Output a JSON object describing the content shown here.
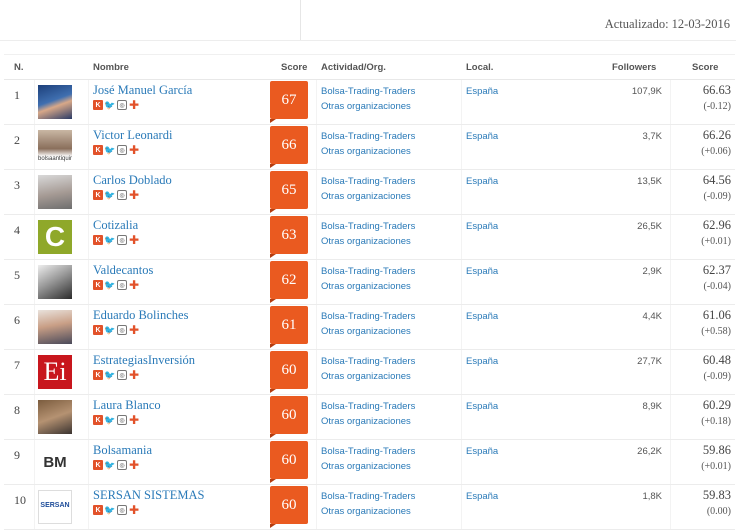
{
  "updated_label": "Actualizado: 12-03-2016",
  "columns": {
    "rank": "N.",
    "name": "Nombre",
    "score": "Score",
    "activity": "Actividad/Org.",
    "local": "Local.",
    "followers": "Followers",
    "score2": "Score"
  },
  "icon_legend": {
    "k": "K",
    "tw": "🐦",
    "ig": "◎",
    "plus": "✚"
  },
  "rows": [
    {
      "rank": "1",
      "name": "José Manuel García",
      "badge": "67",
      "act1": "Bolsa-Trading-Traders",
      "act2": "Otras organizaciones",
      "local": "España",
      "followers": "107,9K",
      "score": "66.63",
      "delta": "(-0.12)",
      "avatar": "photo-blue",
      "avatar_text": ""
    },
    {
      "rank": "2",
      "name": "Victor Leonardi",
      "badge": "66",
      "act1": "Bolsa-Trading-Traders",
      "act2": "Otras organizaciones",
      "local": "España",
      "followers": "3,7K",
      "score": "66.26",
      "delta": "(+0.06)",
      "avatar": "photo-caption",
      "avatar_text": "bolsaantiquinze"
    },
    {
      "rank": "3",
      "name": "Carlos Doblado",
      "badge": "65",
      "act1": "Bolsa-Trading-Traders",
      "act2": "Otras organizaciones",
      "local": "España",
      "followers": "13,5K",
      "score": "64.56",
      "delta": "(-0.09)",
      "avatar": "photo-grey",
      "avatar_text": ""
    },
    {
      "rank": "4",
      "name": "Cotizalia",
      "badge": "63",
      "act1": "Bolsa-Trading-Traders",
      "act2": "Otras organizaciones",
      "local": "España",
      "followers": "26,5K",
      "score": "62.96",
      "delta": "(+0.01)",
      "avatar": "logo-c",
      "avatar_text": "C"
    },
    {
      "rank": "5",
      "name": "Valdecantos",
      "badge": "62",
      "act1": "Bolsa-Trading-Traders",
      "act2": "Otras organizaciones",
      "local": "España",
      "followers": "2,9K",
      "score": "62.37",
      "delta": "(-0.04)",
      "avatar": "photo-bw",
      "avatar_text": ""
    },
    {
      "rank": "6",
      "name": "Eduardo Bolinches",
      "badge": "61",
      "act1": "Bolsa-Trading-Traders",
      "act2": "Otras organizaciones",
      "local": "España",
      "followers": "4,4K",
      "score": "61.06",
      "delta": "(+0.58)",
      "avatar": "photo-light",
      "avatar_text": ""
    },
    {
      "rank": "7",
      "name": "EstrategiasInversión",
      "badge": "60",
      "act1": "Bolsa-Trading-Traders",
      "act2": "Otras organizaciones",
      "local": "España",
      "followers": "27,7K",
      "score": "60.48",
      "delta": "(-0.09)",
      "avatar": "logo-ei",
      "avatar_text": "Ei"
    },
    {
      "rank": "8",
      "name": "Laura Blanco",
      "badge": "60",
      "act1": "Bolsa-Trading-Traders",
      "act2": "Otras organizaciones",
      "local": "España",
      "followers": "8,9K",
      "score": "60.29",
      "delta": "(+0.18)",
      "avatar": "photo-warm",
      "avatar_text": ""
    },
    {
      "rank": "9",
      "name": "Bolsamania",
      "badge": "60",
      "act1": "Bolsa-Trading-Traders",
      "act2": "Otras organizaciones",
      "local": "España",
      "followers": "26,2K",
      "score": "59.86",
      "delta": "(+0.01)",
      "avatar": "logo-bm",
      "avatar_text": "BM"
    },
    {
      "rank": "10",
      "name": "SERSAN SISTEMAS",
      "badge": "60",
      "act1": "Bolsa-Trading-Traders",
      "act2": "Otras organizaciones",
      "local": "España",
      "followers": "1,8K",
      "score": "59.83",
      "delta": "(0.00)",
      "avatar": "logo-sersan",
      "avatar_text": "SERSAN"
    }
  ],
  "colors": {
    "badge": "#ea5a20",
    "link": "#2a7ab8"
  }
}
